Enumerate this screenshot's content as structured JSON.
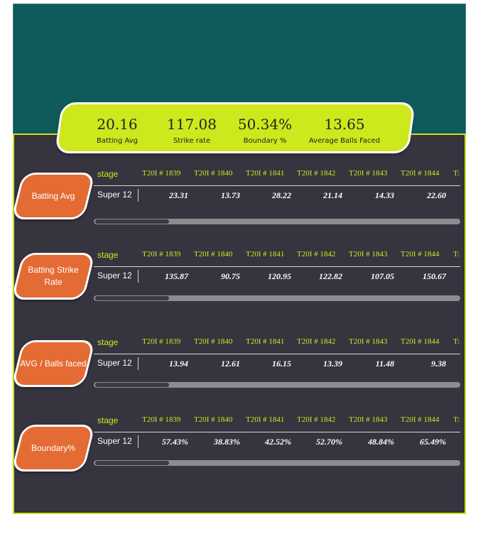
{
  "kpis": [
    {
      "value": "20.16",
      "label": "Batting Avg"
    },
    {
      "value": "117.08",
      "label": "Strike rate"
    },
    {
      "value": "50.34%",
      "label": "Boundary %"
    },
    {
      "value": "13.65",
      "label": "Average Balls Faced"
    }
  ],
  "columns": [
    "T20I # 1839",
    "T20I # 1840",
    "T20I # 1841",
    "T20I # 1842",
    "T20I # 1843",
    "T20I # 1844",
    "T:"
  ],
  "stage_header": "stage",
  "sections": [
    {
      "tag": "Batting Avg",
      "stage": "Super 12",
      "values": [
        "23.31",
        "13.73",
        "28.22",
        "21.14",
        "14.33",
        "22.60"
      ]
    },
    {
      "tag": "Batting Strike Rate",
      "stage": "Super 12",
      "values": [
        "135.87",
        "90.75",
        "120.95",
        "122.82",
        "107.05",
        "150.67"
      ]
    },
    {
      "tag": "AVG / Balls faced",
      "stage": "Super 12",
      "values": [
        "13.94",
        "12.61",
        "16.15",
        "13.39",
        "11.48",
        "9.38"
      ]
    },
    {
      "tag": "Boundary%",
      "stage": "Super 12",
      "values": [
        "57.43%",
        "38.83%",
        "42.52%",
        "52.70%",
        "48.84%",
        "65.49%"
      ]
    }
  ],
  "colors": {
    "teal": "#0f5a5a",
    "dark": "#35343f",
    "accent": "#cde81c",
    "tag": "#e46b34"
  }
}
